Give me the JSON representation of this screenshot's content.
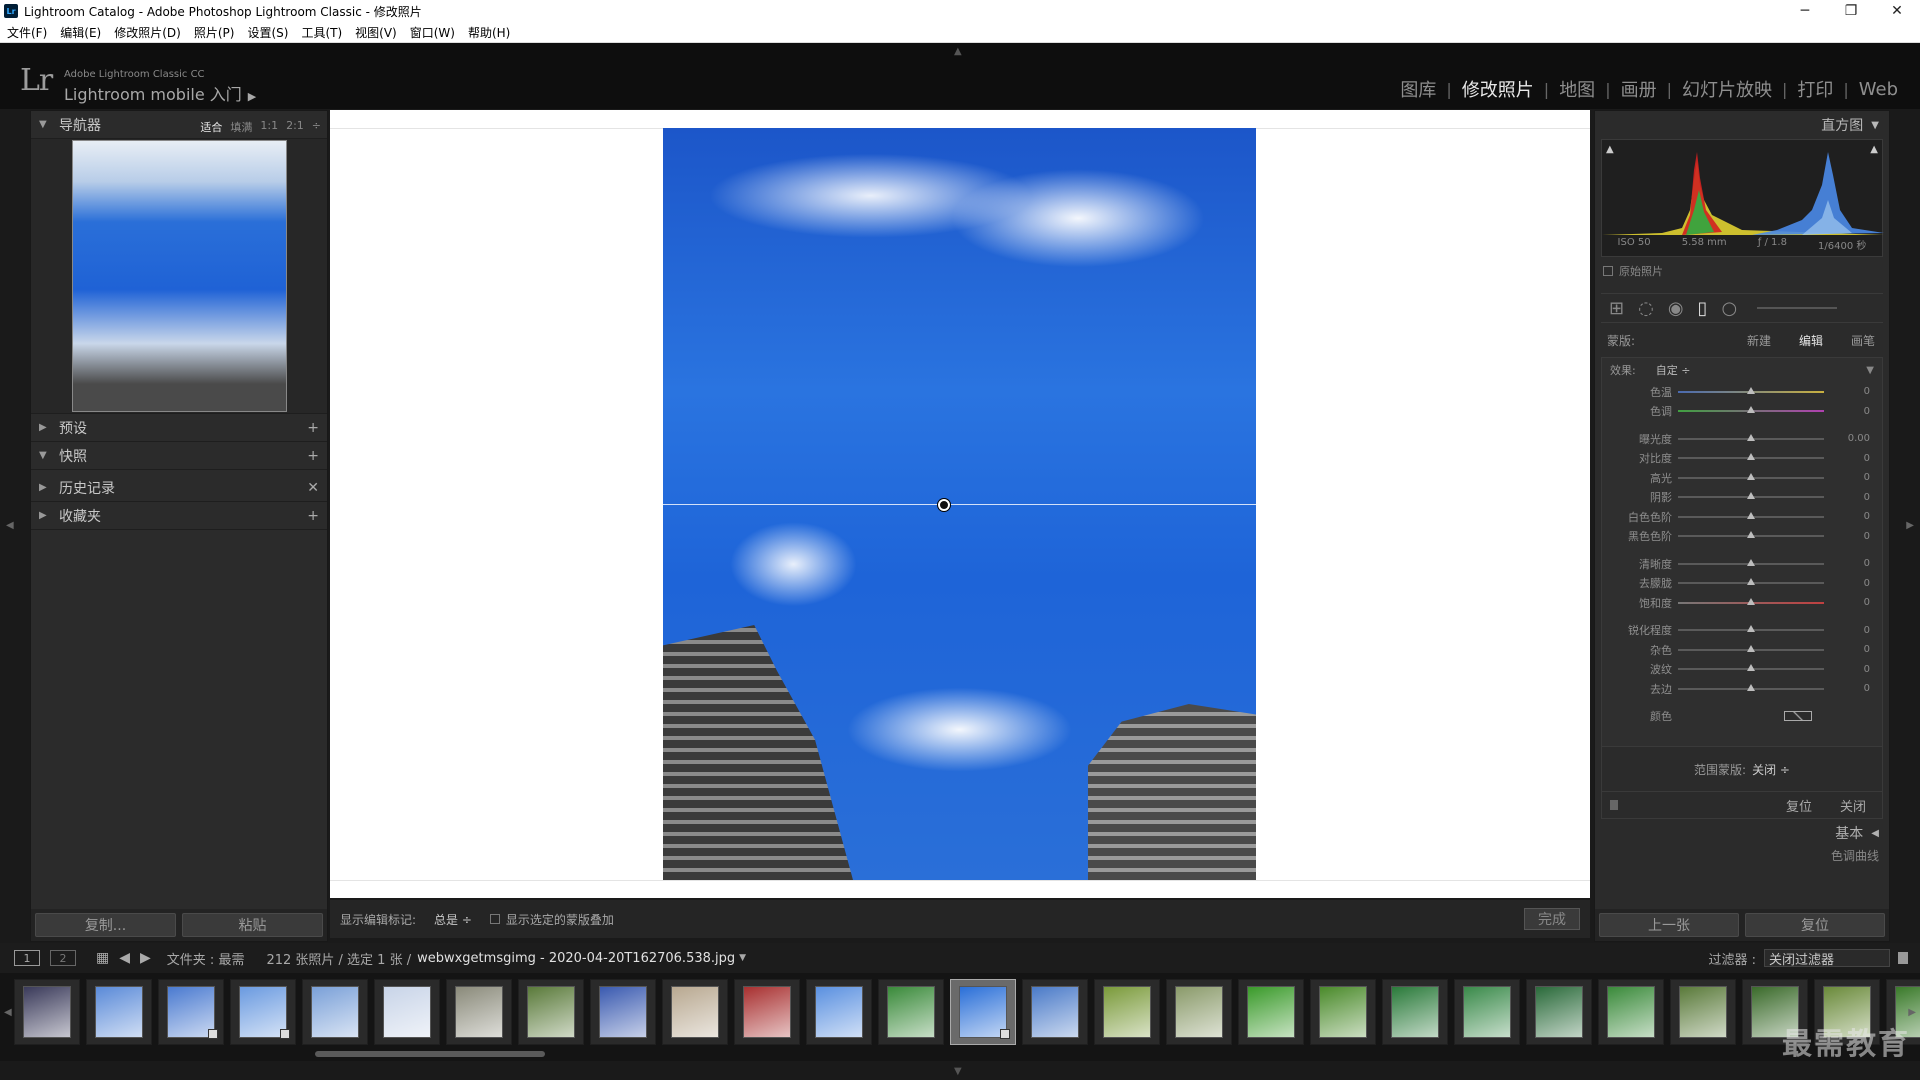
{
  "window": {
    "title": "Lightroom Catalog - Adobe Photoshop Lightroom Classic - 修改照片",
    "app_icon": "Lr",
    "controls": [
      "─",
      "❐",
      "✕"
    ]
  },
  "menu": [
    "文件(F)",
    "编辑(E)",
    "修改照片(D)",
    "照片(P)",
    "设置(S)",
    "工具(T)",
    "视图(V)",
    "窗口(W)",
    "帮助(H)"
  ],
  "identity": {
    "logo": "Lr",
    "subtitle": "Adobe Lightroom Classic CC",
    "mobile_label": "Lightroom mobile 入门",
    "mobile_arrow": "▶",
    "collapse_arrow": "▲"
  },
  "modules": [
    {
      "label": "图库"
    },
    {
      "label": "修改照片"
    },
    {
      "label": "地图"
    },
    {
      "label": "画册"
    },
    {
      "label": "幻灯片放映"
    },
    {
      "label": "打印"
    },
    {
      "label": "Web"
    }
  ],
  "module_separator": "|",
  "left_panel": {
    "navigator": {
      "title": "导航器",
      "zoom": [
        "适合",
        "填满",
        "1:1",
        "2:1"
      ],
      "zoom_stepper": "÷"
    },
    "sections": [
      {
        "title": "预设",
        "action": "+"
      },
      {
        "title": "快照",
        "action": "+"
      },
      {
        "title": "历史记录",
        "action": "✕"
      },
      {
        "title": "收藏夹",
        "action": "+"
      }
    ],
    "copy_button": "复制...",
    "paste_button": "粘贴"
  },
  "toolbar": {
    "show_pins_label": "显示编辑标记:",
    "show_pins_value": "总是 ÷",
    "overlay_label": "显示选定的蒙版叠加",
    "done_button": "完成"
  },
  "right_panel": {
    "histogram": {
      "title": "直方图",
      "iso": "ISO 50",
      "focal": "5.58 mm",
      "aperture": "ƒ / 1.8",
      "shutter": "1/6400 秒",
      "original_label": "原始照片"
    },
    "mask": {
      "label": "蒙版:",
      "new": "新建",
      "edit": "编辑",
      "brush": "画笔"
    },
    "effects": {
      "label": "效果:",
      "value": "自定 ÷",
      "sliders_group1": [
        {
          "label": "色温",
          "value": "0"
        },
        {
          "label": "色调",
          "value": "0"
        }
      ],
      "sliders_group2": [
        {
          "label": "曝光度",
          "value": "0.00"
        },
        {
          "label": "对比度",
          "value": "0"
        },
        {
          "label": "高光",
          "value": "0"
        },
        {
          "label": "阴影",
          "value": "0"
        },
        {
          "label": "白色色阶",
          "value": "0"
        },
        {
          "label": "黑色色阶",
          "value": "0"
        }
      ],
      "sliders_group3": [
        {
          "label": "清晰度",
          "value": "0"
        },
        {
          "label": "去朦胧",
          "value": "0"
        },
        {
          "label": "饱和度",
          "value": "0"
        }
      ],
      "sliders_group4": [
        {
          "label": "锐化程度",
          "value": "0"
        },
        {
          "label": "杂色",
          "value": "0"
        },
        {
          "label": "波纹",
          "value": "0"
        },
        {
          "label": "去边",
          "value": "0"
        }
      ],
      "color_label": "颜色"
    },
    "range_mask_label": "范围蒙版:",
    "range_mask_value": "关闭 ÷",
    "reset": "复位",
    "close": "关闭",
    "basic_title": "基本",
    "tone_curve_title": "色调曲线",
    "prev_button": "上一张",
    "reset_button": "复位"
  },
  "filmstrip": {
    "monitor1": "1",
    "monitor2": "2",
    "source": "文件夹 : 最需",
    "count": "212 张照片 / 选定 1 张 /",
    "filename": "webwxgetmsgimg - 2020-04-20T162706.538.jpg",
    "filter_label": "过滤器 :",
    "filter_value": "关闭过滤器",
    "watermark": "最需教育",
    "thumb_colors": [
      "#3a3a5a",
      "#5a8ad8",
      "#4a7ad0",
      "#6a9ae0",
      "#7aa0d8",
      "#c8d4e8",
      "#8a8a7a",
      "#5a7a3a",
      "#3a5ab0",
      "#b8a890",
      "#a83030",
      "#5a90e0",
      "#3a8a3a",
      "#2a6fd8",
      "#4a7ac8",
      "#7a9a3a",
      "#8a9a6a",
      "#3a9a2a",
      "#4a8a2a",
      "#2a7a3a",
      "#3a8a4a",
      "#2a6a3a",
      "#3a8a3a",
      "#5a7a3a",
      "#3a6a2a",
      "#6a8a3a",
      "#3a7a2a"
    ],
    "badged_indexes": [
      2,
      3,
      13
    ]
  }
}
